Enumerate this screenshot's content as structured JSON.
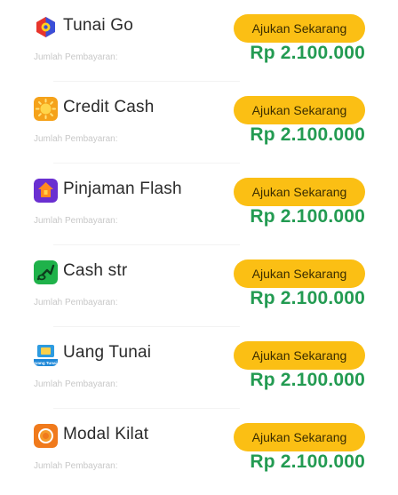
{
  "loans": [
    {
      "name": "Tunai Go",
      "icon": "tunai-go-logo-icon",
      "amount_label": "Jumlah Pembayaran:",
      "button_label": "Ajukan Sekarang",
      "amount": "Rp 2.100.000"
    },
    {
      "name": "Credit Cash",
      "icon": "credit-cash-logo-icon",
      "amount_label": "Jumlah Pembayaran:",
      "button_label": "Ajukan Sekarang",
      "amount": "Rp 2.100.000"
    },
    {
      "name": "Pinjaman Flash",
      "icon": "pinjaman-flash-logo-icon",
      "amount_label": "Jumlah Pembayaran:",
      "button_label": "Ajukan Sekarang",
      "amount": "Rp 2.100.000"
    },
    {
      "name": "Cash str",
      "icon": "cash-str-logo-icon",
      "amount_label": "Jumlah Pembayaran:",
      "button_label": "Ajukan Sekarang",
      "amount": "Rp 2.100.000"
    },
    {
      "name": "Uang Tunai",
      "icon": "uang-tunai-logo-icon",
      "icon_text": "Uang Tunai",
      "amount_label": "Jumlah Pembayaran:",
      "button_label": "Ajukan Sekarang",
      "amount": "Rp 2.100.000"
    },
    {
      "name": "Modal Kilat",
      "icon": "modal-kilat-logo-icon",
      "amount_label": "Jumlah Pembayaran:",
      "button_label": "Ajukan Sekarang",
      "amount": "Rp 2.100.000"
    }
  ],
  "colors": {
    "button": "#fbbf14",
    "amount": "#239b52",
    "label": "#c8c8c8"
  }
}
